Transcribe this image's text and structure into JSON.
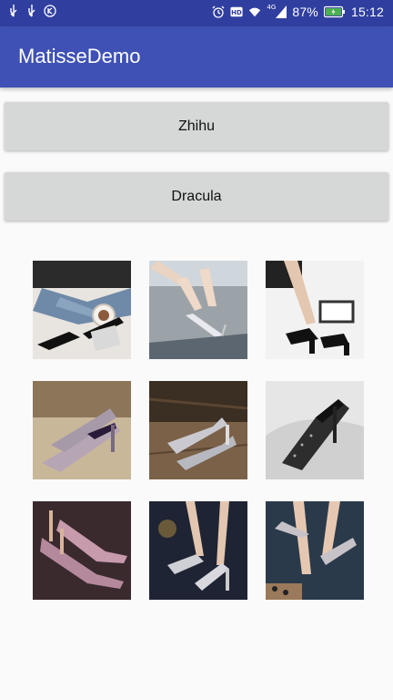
{
  "status_bar": {
    "icons_left": [
      "usb-icon",
      "usb-icon",
      "k-app-icon"
    ],
    "icons_right": [
      "alarm-icon",
      "hd-icon",
      "wifi-icon",
      "signal-icon"
    ],
    "network": "4G",
    "battery": "87%",
    "time": "15:12",
    "color": "#303f9f"
  },
  "app_bar": {
    "title": "MatisseDemo",
    "color": "#3f51b5"
  },
  "buttons": [
    {
      "label": "Zhihu"
    },
    {
      "label": "Dracula"
    }
  ],
  "images": [
    {
      "name": "photo-black-heels-jeans"
    },
    {
      "name": "photo-silver-heels-legs"
    },
    {
      "name": "photo-black-strap-heels"
    },
    {
      "name": "photo-purple-glitter-heels"
    },
    {
      "name": "photo-silver-glitter-heels-wood"
    },
    {
      "name": "photo-black-glitter-heel"
    },
    {
      "name": "photo-pink-glitter-heels"
    },
    {
      "name": "photo-silver-ankle-strap-heels"
    },
    {
      "name": "photo-glitter-heels-legs"
    }
  ]
}
